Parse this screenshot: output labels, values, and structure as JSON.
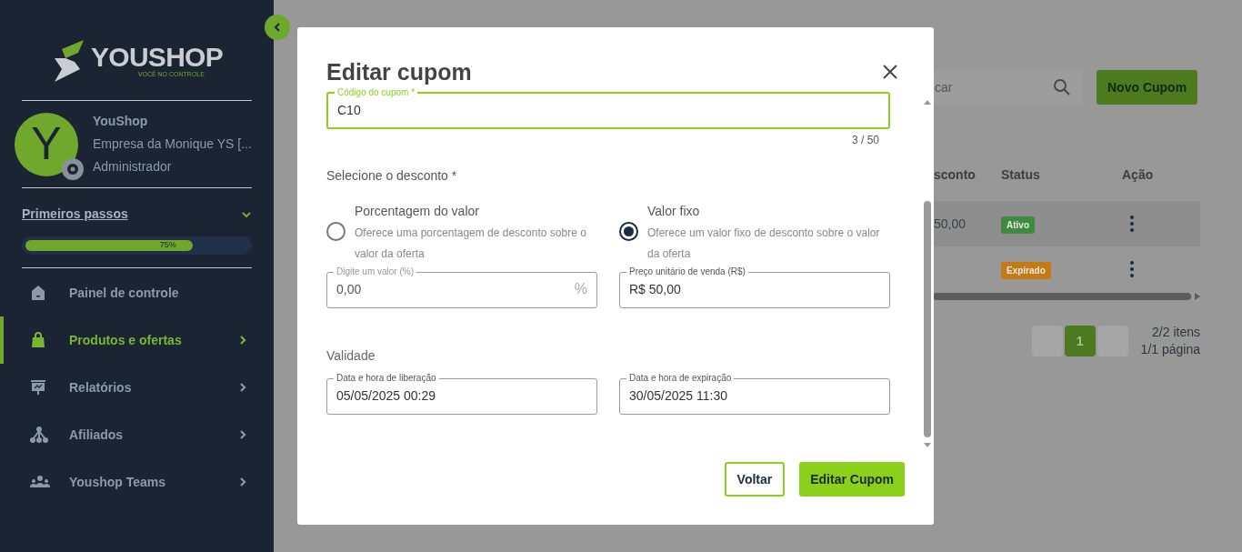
{
  "sidebar": {
    "logo": {
      "name": "YOUSHOP",
      "tagline": "VOCÊ NO CONTROLE"
    },
    "user": {
      "initial": "Y",
      "name": "YouShop",
      "company": "Empresa da Monique YS [...",
      "role": "Administrador"
    },
    "onboarding": {
      "title": "Primeiros passos",
      "expanded": true,
      "level": 0.75,
      "percent": "75%"
    },
    "nav": [
      {
        "label": "Painel de controle",
        "kind": "home",
        "selected": false,
        "arrow": false
      },
      {
        "label": "Produtos e ofertas",
        "kind": "bag",
        "selected": true,
        "arrow": true
      },
      {
        "label": "Relatórios",
        "kind": "report",
        "selected": false,
        "arrow": true
      },
      {
        "label": "Afiliados",
        "kind": "network",
        "selected": false,
        "arrow": true
      },
      {
        "label": "Youshop Teams",
        "kind": "team",
        "selected": false,
        "arrow": true
      }
    ]
  },
  "page": {
    "search": {
      "placeholder": "car"
    },
    "new_button": "Novo Cupom",
    "table": {
      "columns": [
        "sconto",
        "Status",
        "Ação"
      ],
      "rows": [
        {
          "discount": "50,00",
          "status": "Ativo",
          "color": "#3e8a3e"
        },
        {
          "status": "Expirado",
          "color": "#c67a14"
        }
      ]
    },
    "pagination": {
      "current": "1",
      "items": "2/2 itens",
      "pages": "1/1 página"
    }
  },
  "modal": {
    "title": "Editar cupom",
    "code": {
      "label": "Código do cupom *",
      "value": "C10",
      "counter": "3 / 50"
    },
    "discount_label": "Selecione o desconto *",
    "options": [
      {
        "title": "Porcentagem do valor",
        "description": "Oferece uma porcentagem de desconto sobre o valor da oferta",
        "selected": false,
        "field": {
          "label": "Digite um valor (%)",
          "value": "0,00",
          "suffix": "%",
          "disabled": true
        }
      },
      {
        "title": "Valor fixo",
        "description": "Oferece um valor fixo de desconto sobre o valor da oferta",
        "selected": true,
        "field": {
          "label": "Preço unitário de venda (R$)",
          "value": "R$ 50,00",
          "disabled": false
        }
      }
    ],
    "validity_label": "Validade",
    "dates": [
      {
        "label": "Data e hora de liberação",
        "value": "05/05/2025 00:29"
      },
      {
        "label": "Data e hora de expiração",
        "value": "30/05/2025 11:30"
      }
    ],
    "buttons": {
      "back": "Voltar",
      "submit": "Editar Cupom"
    }
  }
}
